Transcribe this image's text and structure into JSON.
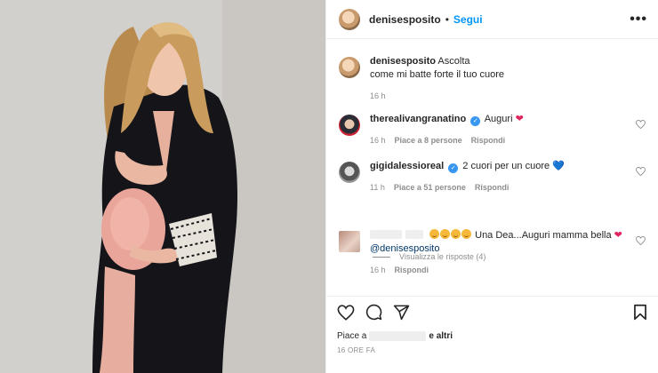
{
  "post": {
    "username": "denisesposito",
    "separator": "•",
    "follow_label": "Segui",
    "more_label": "•••"
  },
  "caption": {
    "username": "denisesposito",
    "text_line1": "Ascolta",
    "text_line2": "come mi batte forte il tuo cuore",
    "age": "16 h"
  },
  "comments": [
    {
      "username": "therealivangranatino",
      "text": "Auguri",
      "emoji": "❤",
      "age": "16 h",
      "likes": "Piace a 8 persone",
      "reply": "Rispondi"
    },
    {
      "username": "gigidalessioreal",
      "text": "2 cuori per un cuore",
      "emoji": "💙",
      "age": "11 h",
      "likes": "Piace a 51 persone",
      "reply": "Rispondi"
    },
    {
      "text": "Una Dea...Auguri mamma bella",
      "emoji": "❤",
      "mention": "@denisesposito",
      "age": "16 h",
      "reply": "Rispondi"
    }
  ],
  "view_replies": "Visualizza le risposte (4)",
  "likes_prefix": "Piace a",
  "likes_suffix": "e altri",
  "post_time": "16 ORE FA",
  "icons": [
    "heart-icon",
    "comment-icon",
    "share-icon",
    "bookmark-icon",
    "more-icon",
    "verified-icon"
  ],
  "colors": {
    "accent": "#0095f6",
    "heart": "#e0245e",
    "verified": "#3897f0"
  }
}
